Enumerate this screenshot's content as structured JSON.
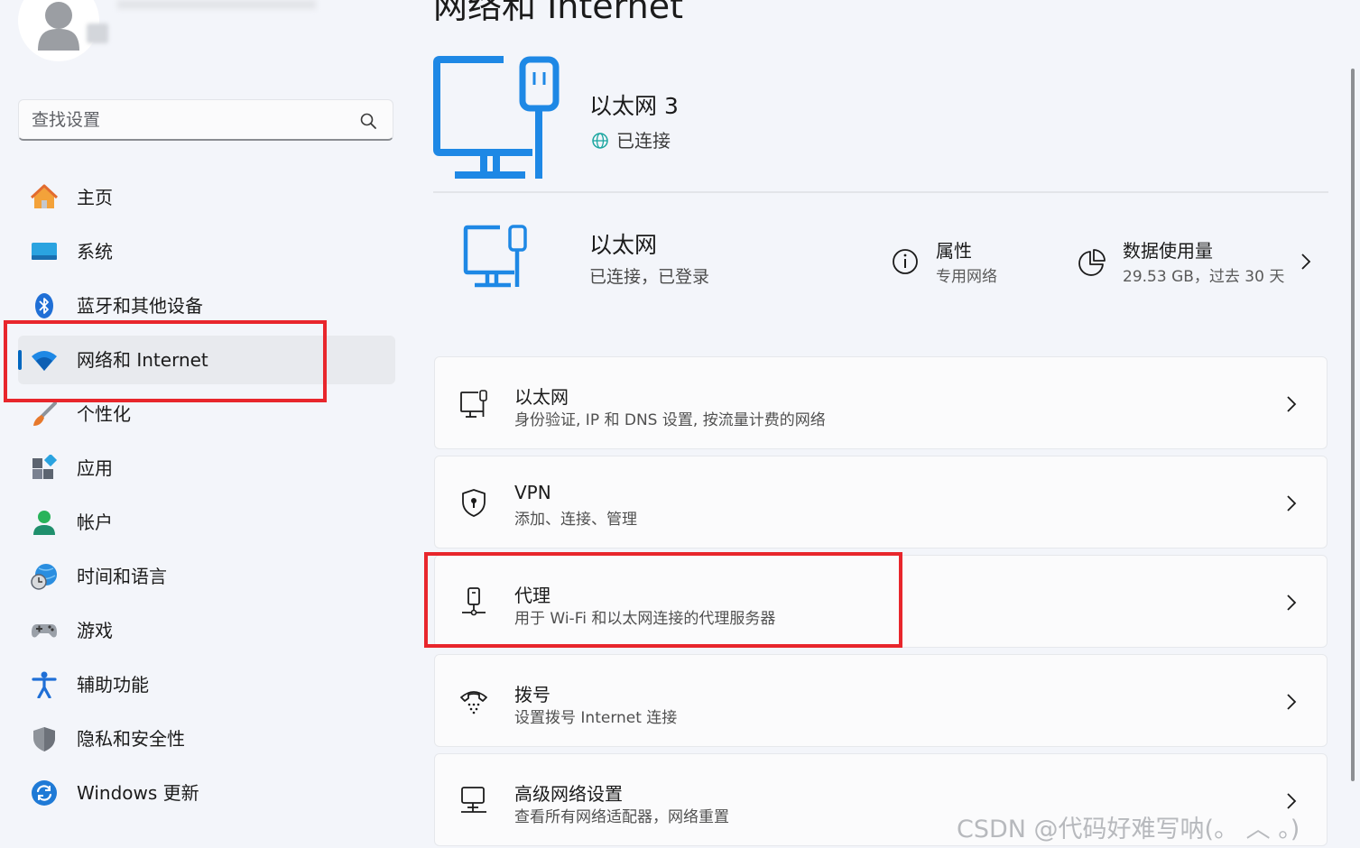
{
  "user": {
    "avatar_icon": "user-avatar-icon"
  },
  "search": {
    "placeholder": "查找设置",
    "icon": "search-icon"
  },
  "sidebar": {
    "items": [
      {
        "label": "主页",
        "icon": "home-icon"
      },
      {
        "label": "系统",
        "icon": "system-icon"
      },
      {
        "label": "蓝牙和其他设备",
        "icon": "bluetooth-icon"
      },
      {
        "label": "网络和 Internet",
        "icon": "wifi-icon",
        "active": true
      },
      {
        "label": "个性化",
        "icon": "brush-icon"
      },
      {
        "label": "应用",
        "icon": "apps-icon"
      },
      {
        "label": "帐户",
        "icon": "account-icon"
      },
      {
        "label": "时间和语言",
        "icon": "time-language-icon"
      },
      {
        "label": "游戏",
        "icon": "gamepad-icon"
      },
      {
        "label": "辅助功能",
        "icon": "accessibility-icon"
      },
      {
        "label": "隐私和安全性",
        "icon": "shield-icon"
      },
      {
        "label": "Windows 更新",
        "icon": "update-icon"
      }
    ]
  },
  "page": {
    "title": "网络和 Internet"
  },
  "connection": {
    "name": "以太网 3",
    "status": "已连接",
    "status_icon": "globe-icon",
    "icon": "ethernet-monitor-icon"
  },
  "summary": {
    "title": "以太网",
    "subtitle": "已连接，已登录",
    "properties": {
      "title": "属性",
      "subtitle": "专用网络",
      "icon": "info-icon"
    },
    "data_usage": {
      "title": "数据使用量",
      "subtitle": "29.53 GB，过去 30 天",
      "icon": "pie-chart-icon"
    }
  },
  "cards": [
    {
      "title": "以太网",
      "subtitle": "身份验证, IP 和 DNS 设置, 按流量计费的网络",
      "icon": "ethernet-icon"
    },
    {
      "title": "VPN",
      "subtitle": "添加、连接、管理",
      "icon": "vpn-shield-icon"
    },
    {
      "title": "代理",
      "subtitle": "用于 Wi-Fi 和以太网连接的代理服务器",
      "icon": "proxy-icon"
    },
    {
      "title": "拨号",
      "subtitle": "设置拨号 Internet 连接",
      "icon": "dialup-icon"
    },
    {
      "title": "高级网络设置",
      "subtitle": "查看所有网络适配器，网络重置",
      "icon": "advanced-network-icon"
    }
  ],
  "watermark": "CSDN @代码好难写呐(。 ︿ 。)",
  "colors": {
    "accent": "#0067c0",
    "highlight_box": "#e8262c",
    "background": "#f3f5fa",
    "card": "#fbfbfc"
  }
}
